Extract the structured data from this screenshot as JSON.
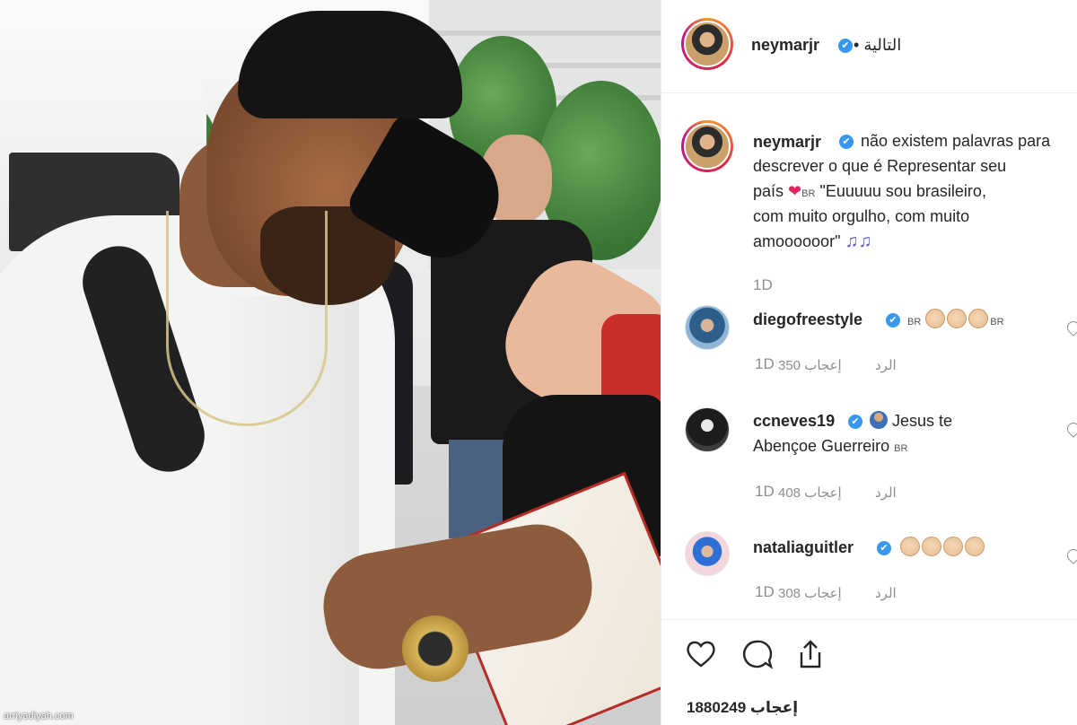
{
  "header": {
    "username": "neymarjr",
    "verified_mark": "✔",
    "follow_label": "• التالية"
  },
  "caption": {
    "username": "neymarjr",
    "line1": "não existem palavras para",
    "line2": "descrever o que é Representar seu",
    "line3_pre": "país",
    "flag": "BR",
    "line3_post": "\"Euuuuu sou brasileiro,",
    "line4": "com muito orgulho, com muito",
    "line5": "amoooooor\"",
    "notes": "♫♫",
    "time": "1D"
  },
  "comments": [
    {
      "username": "diegofreestyle",
      "flag_left": "BR",
      "flag_right": "BR",
      "time": "1D",
      "likes": "350 إعجاب",
      "reply": "الرد"
    },
    {
      "username": "ccneves19",
      "text1": "Jesus te",
      "text2": "Abençoe Guerreiro",
      "flag": "BR",
      "time": "1D",
      "likes": "408 إعجاب",
      "reply": "الرد"
    },
    {
      "username": "nataliaguitler",
      "time": "1D",
      "likes": "308 إعجاب",
      "reply": "الرد"
    }
  ],
  "footer": {
    "likes_count": "1880249 إعجاب"
  },
  "watermark": "arriyadiyah.com",
  "icons": [
    "heart-icon",
    "comment-icon",
    "share-icon"
  ],
  "colors": {
    "verified": "#3897f0",
    "heart": "#e0245e",
    "meta": "#8e8e8e"
  }
}
